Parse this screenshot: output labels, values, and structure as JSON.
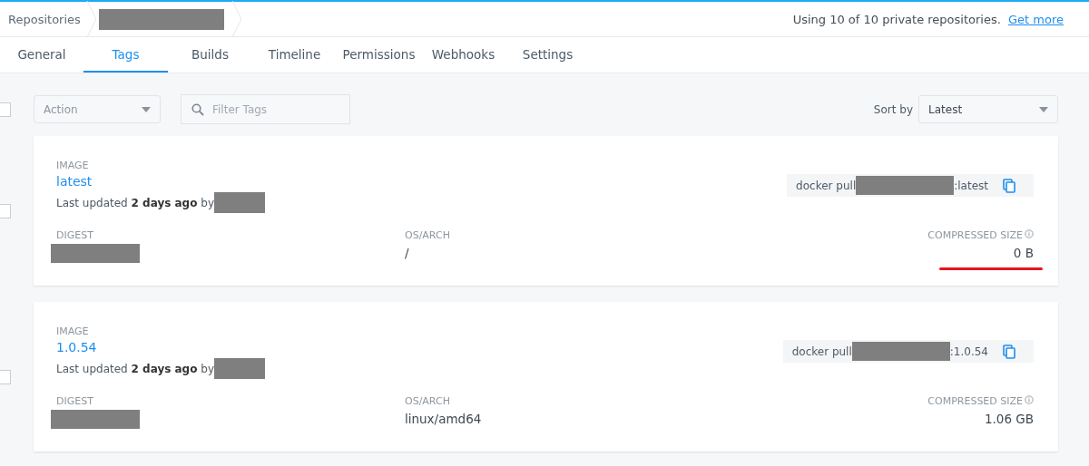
{
  "breadcrumb": {
    "root": "Repositories",
    "current_redacted": true
  },
  "usage": {
    "text": "Using 10 of 10 private repositories.",
    "link": "Get more"
  },
  "tabs": [
    {
      "label": "General",
      "selected": false
    },
    {
      "label": "Tags",
      "selected": true
    },
    {
      "label": "Builds",
      "selected": false
    },
    {
      "label": "Timeline",
      "selected": false
    },
    {
      "label": "Permissions",
      "selected": false
    },
    {
      "label": "Webhooks",
      "selected": false
    },
    {
      "label": "Settings",
      "selected": false
    }
  ],
  "toolbar": {
    "select_all_checked": false,
    "action": {
      "placeholder": "Action"
    },
    "filter": {
      "placeholder": "Filter Tags"
    },
    "sort_label": "Sort by",
    "sort_value": "Latest"
  },
  "tags": [
    {
      "checked": false,
      "image_label": "IMAGE",
      "name": "latest",
      "updated_prefix": "Last updated",
      "updated_when": "2 days ago",
      "updated_by": "by",
      "pull_prefix": "docker pull",
      "pull_suffix": ":latest",
      "digest_label": "DIGEST",
      "os_label": "OS/ARCH",
      "os_value": "/",
      "size_label": "COMPRESSED SIZE",
      "size_value": "0 B",
      "size_underlined": true
    },
    {
      "checked": false,
      "image_label": "IMAGE",
      "name": "1.0.54",
      "updated_prefix": "Last updated",
      "updated_when": "2 days ago",
      "updated_by": "by",
      "pull_prefix": "docker pull",
      "pull_suffix": ":1.0.54",
      "digest_label": "DIGEST",
      "os_label": "OS/ARCH",
      "os_value": "linux/amd64",
      "size_label": "COMPRESSED SIZE",
      "size_value": "1.06 GB",
      "size_underlined": false
    }
  ]
}
